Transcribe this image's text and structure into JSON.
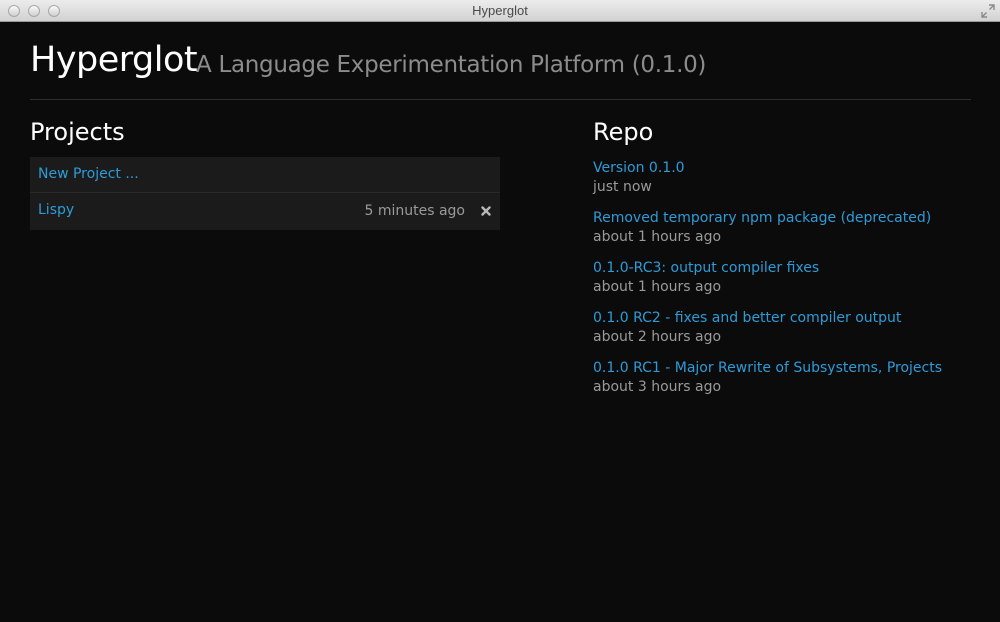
{
  "window": {
    "title": "Hyperglot"
  },
  "header": {
    "app_name": "Hyperglot",
    "subtitle": "A Language Experimentation Platform (0.1.0)"
  },
  "projects": {
    "title": "Projects",
    "new_project_label": "New Project ...",
    "items": [
      {
        "name": "Lispy",
        "modified": "5 minutes ago",
        "delete_icon": "close-x-icon"
      }
    ]
  },
  "repo": {
    "title": "Repo",
    "commits": [
      {
        "message": "Version 0.1.0",
        "time": "just now"
      },
      {
        "message": "Removed temporary npm package (deprecated)",
        "time": "about 1 hours ago"
      },
      {
        "message": "0.1.0-RC3: output compiler fixes",
        "time": "about 1 hours ago"
      },
      {
        "message": "0.1.0 RC2 - fixes and better compiler output",
        "time": "about 2 hours ago"
      },
      {
        "message": "0.1.0 RC1 - Major Rewrite of Subsystems, Projects",
        "time": "about 3 hours ago"
      }
    ]
  },
  "colors": {
    "background": "#0b0b0b",
    "link": "#2e9bd8",
    "muted": "#9a9a9a",
    "row": "#1b1b1b"
  }
}
